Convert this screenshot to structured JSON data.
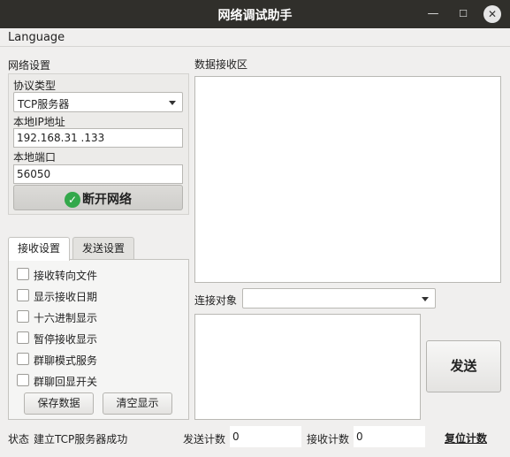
{
  "window": {
    "title": "网络调试助手",
    "minimize_glyph": "—",
    "maximize_glyph": "☐",
    "close_glyph": "✕"
  },
  "menu": {
    "language": "Language"
  },
  "network": {
    "group_title": "网络设置",
    "protocol_label": "协议类型",
    "protocol_value": "TCP服务器",
    "ip_label": "本地IP地址",
    "ip_value": "192.168.31 .133",
    "port_label": "本地端口",
    "port_value": "56050",
    "connect_button": "断开网络",
    "connect_icon": "check-circle-icon",
    "connect_icon_glyph": "✓",
    "connect_icon_color": "#33a84b"
  },
  "tabs": [
    {
      "label": "接收设置",
      "active": true
    },
    {
      "label": "发送设置",
      "active": false
    }
  ],
  "receive_options": [
    {
      "label": "接收转向文件",
      "checked": false
    },
    {
      "label": "显示接收日期",
      "checked": false
    },
    {
      "label": "十六进制显示",
      "checked": false
    },
    {
      "label": "暂停接收显示",
      "checked": false
    },
    {
      "label": "群聊模式服务",
      "checked": false
    },
    {
      "label": "群聊回显开关",
      "checked": false
    }
  ],
  "receive_buttons": {
    "save": "保存数据",
    "clear": "清空显示"
  },
  "receive_area": {
    "title": "数据接收区",
    "content": ""
  },
  "connection": {
    "target_label": "连接对象",
    "target_value": ""
  },
  "send": {
    "content": "",
    "button": "发送"
  },
  "status": {
    "label": "状态",
    "message": "建立TCP服务器成功",
    "sent_label": "发送计数",
    "sent_value": "0",
    "recv_label": "接收计数",
    "recv_value": "0",
    "reset": "复位计数"
  }
}
